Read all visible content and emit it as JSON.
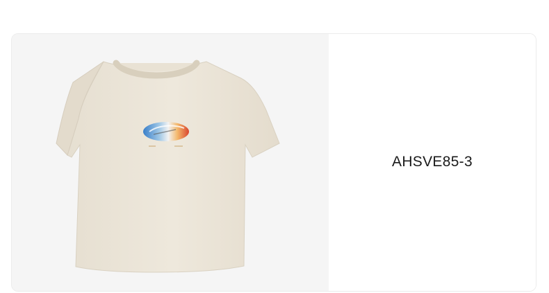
{
  "product": {
    "sku": "AHSVE85-3",
    "image_icon": "t-shirt-product-image",
    "shirt_color": "#ebe4d7",
    "panel_background": "#f5f5f5"
  }
}
